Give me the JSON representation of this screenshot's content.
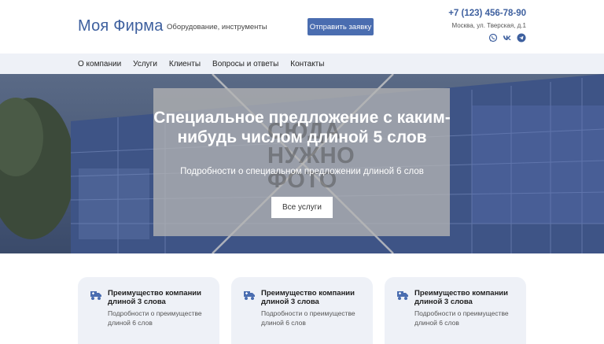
{
  "header": {
    "logo": "Моя Фирма",
    "tagline": "Оборудование, инструменты",
    "cta_label": "Отправить заявку",
    "phone": "+7 (123) 456-78-90",
    "address": "Москва, ул. Тверская, д.1",
    "socials": [
      "whatsapp-icon",
      "vk-icon",
      "telegram-icon"
    ]
  },
  "nav": {
    "items": [
      "О компании",
      "Услуги",
      "Клиенты",
      "Вопросы и ответы",
      "Контакты"
    ]
  },
  "hero": {
    "placeholder": "СЮДА НУЖНО ФОТО",
    "title": "Специальное предложение с каким-нибудь числом длиной 5 слов",
    "subtitle": "Подробности о специальном предложении длиной 6 слов",
    "button_label": "Все услуги"
  },
  "features": [
    {
      "title": "Преимущество компании длиной 3 слова",
      "text": "Подробности о преимуществе длиной 6 слов",
      "icon": "truck-icon"
    },
    {
      "title": "Преимущество компании длиной 3 слова",
      "text": "Подробности о преимуществе длиной 6 слов",
      "icon": "truck-icon"
    },
    {
      "title": "Преимущество компании длиной 3 слова",
      "text": "Подробности о преимуществе длиной 6 слов",
      "icon": "truck-icon"
    }
  ],
  "colors": {
    "brand": "#3d5f9e",
    "button": "#4a6db0",
    "nav_bg": "#eef1f7"
  }
}
